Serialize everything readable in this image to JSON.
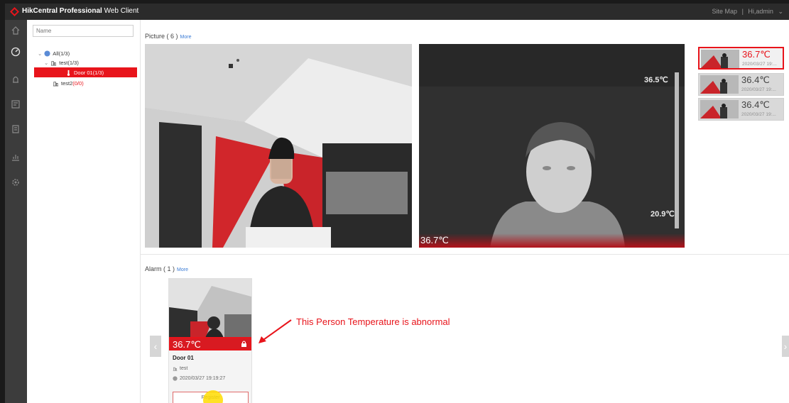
{
  "app": {
    "title_bold": "HikCentral Professional",
    "title_rest": "Web Client",
    "site_map": "Site Map",
    "separator": "|",
    "user": "Hi,admin",
    "brand_color": "#e8141b"
  },
  "rail": {
    "icons": [
      "home-icon",
      "dashboard-icon",
      "alarm-bell-icon",
      "event-center-icon",
      "report-icon",
      "statistics-icon",
      "settings-icon"
    ],
    "active": "dashboard-icon"
  },
  "tree": {
    "search_placeholder": "Name",
    "nodes": [
      {
        "label": "All",
        "count": "(1/3)"
      },
      {
        "label": "test",
        "count": "(1/3)"
      },
      {
        "label": "Door 01",
        "count": "(1/3)"
      },
      {
        "label": "test2",
        "count": "(0/0)"
      }
    ]
  },
  "picture": {
    "title": "Picture ( 6 )",
    "more": "More",
    "thermal_temp": "36.7℃",
    "scale_max": "36.5℃",
    "scale_min": "20.9℃",
    "thumbs": [
      {
        "temp": "36.7℃",
        "time": "2020/03/27 19:..."
      },
      {
        "temp": "36.4℃",
        "time": "2020/03/27 19:..."
      },
      {
        "temp": "36.4℃",
        "time": "2020/03/27 19:..."
      }
    ]
  },
  "alarm": {
    "title": "Alarm ( 1 )",
    "more": "More",
    "card": {
      "temp": "36.7℃",
      "name": "Door 01",
      "area": "test",
      "time": "2020/03/27 19:19:27",
      "register": "Register"
    },
    "annotation": "This Person Temperature is abnormal"
  }
}
